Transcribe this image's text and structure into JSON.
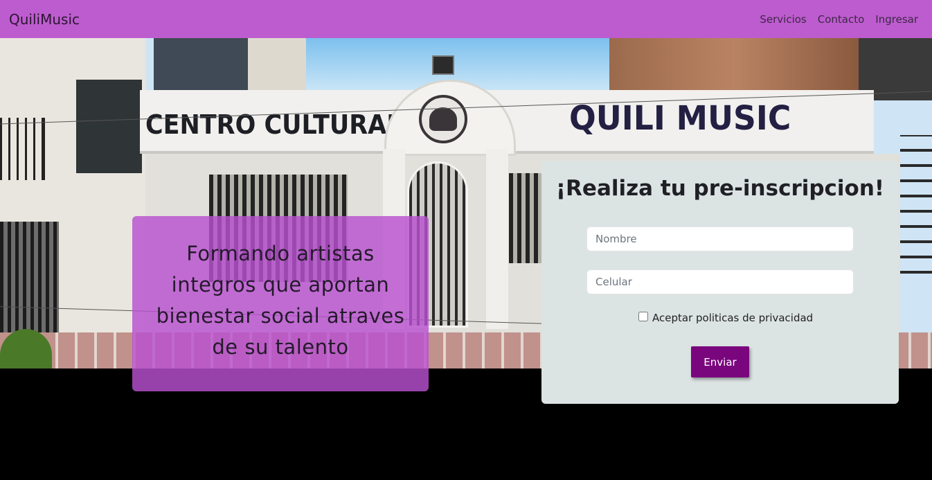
{
  "navbar": {
    "brand": "QuiliMusic",
    "links": [
      "Servicios",
      "Contacto",
      "Ingresar"
    ]
  },
  "hero": {
    "facade_left_text": "CENTRO CULTURAL",
    "facade_right_text": "QUILI MUSIC",
    "tagline": "Formando artistas integros que aportan bienestar social atraves de su talento"
  },
  "form": {
    "title": "¡Realiza tu pre-inscripcion!",
    "nombre_placeholder": "Nombre",
    "celular_placeholder": "Celular",
    "privacy_label": "Aceptar politicas de privacidad",
    "privacy_checked": false,
    "submit_label": "Enviar"
  },
  "colors": {
    "navbar": "#bd5ccf",
    "tagline_box": "#b850cf",
    "form_card": "#dce3e3",
    "submit_button": "#7a067e",
    "footer_background": "#000000"
  }
}
